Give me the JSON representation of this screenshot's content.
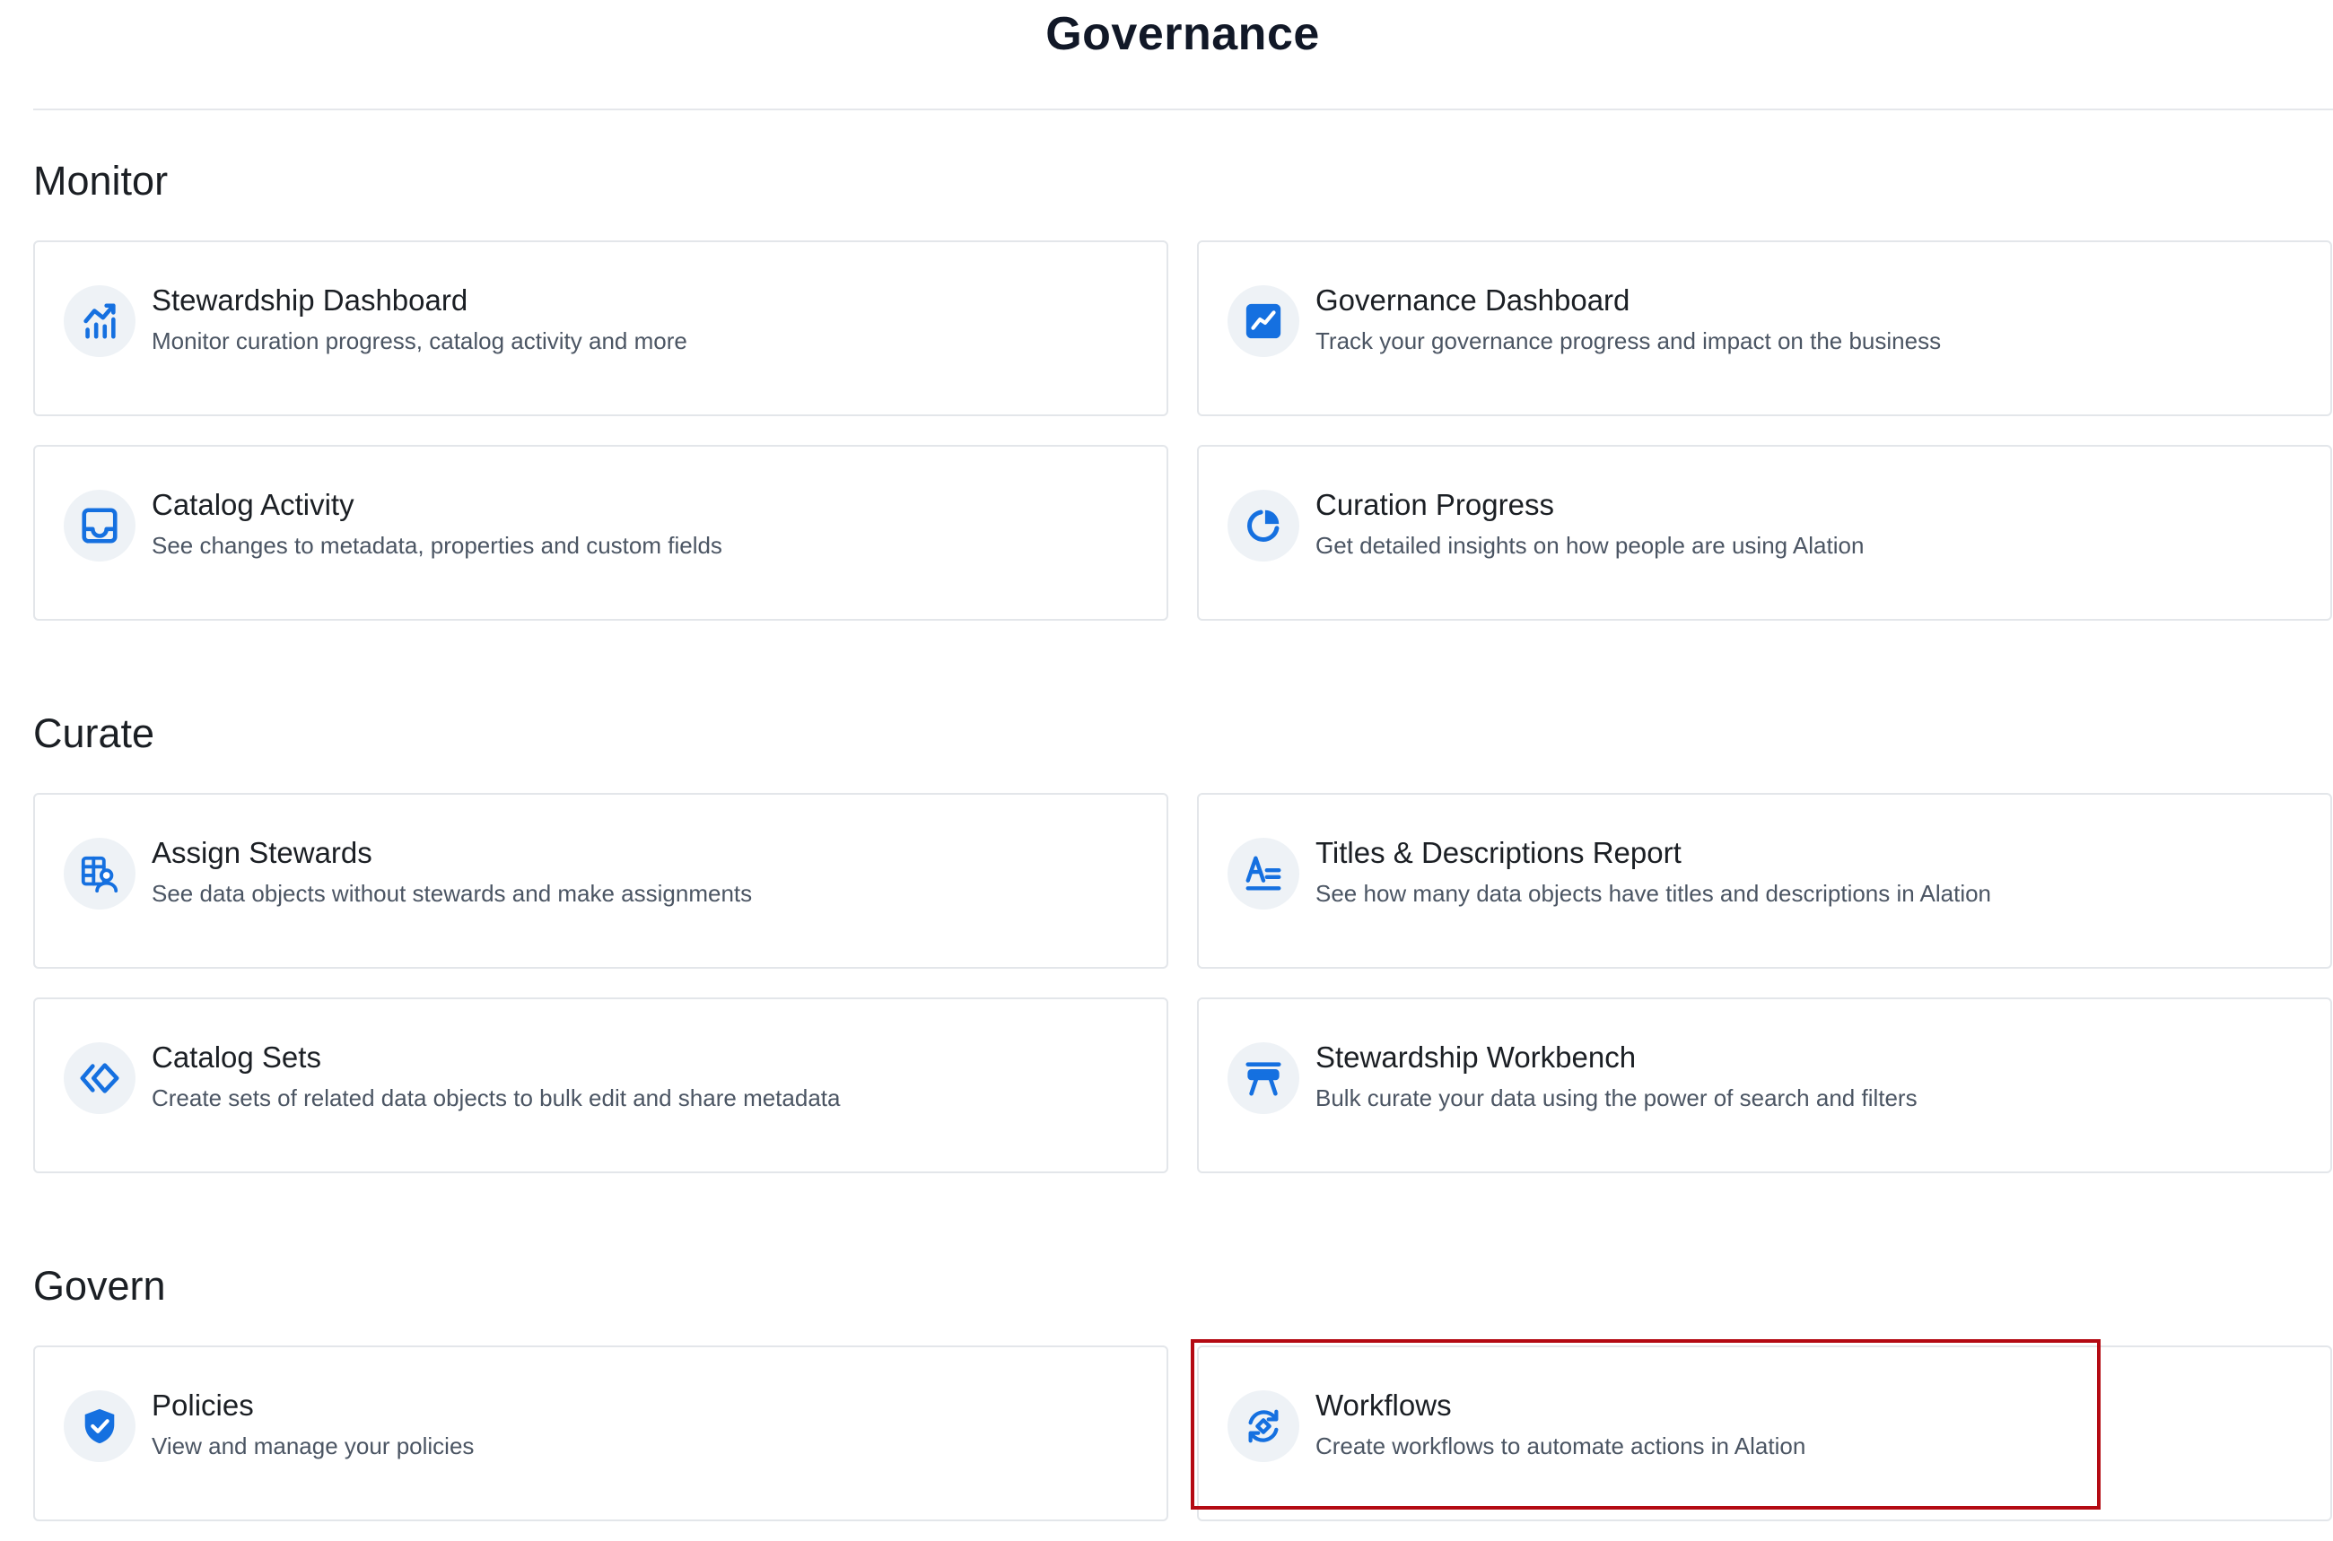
{
  "header": {
    "title": "Governance"
  },
  "colors": {
    "accent": "#1570e0",
    "highlight": "#b40a13"
  },
  "sections": {
    "monitor": {
      "heading": "Monitor",
      "cards": [
        {
          "title": "Stewardship Dashboard",
          "description": "Monitor curation progress, catalog activity and more",
          "icon": "bar-chart-trend-icon"
        },
        {
          "title": "Governance Dashboard",
          "description": "Track your governance progress and impact on the business",
          "icon": "trend-line-icon"
        },
        {
          "title": "Catalog Activity",
          "description": "See changes to metadata, properties and custom fields",
          "icon": "inbox-icon"
        },
        {
          "title": "Curation Progress",
          "description": "Get detailed insights on how people are using Alation",
          "icon": "pie-chart-icon"
        }
      ]
    },
    "curate": {
      "heading": "Curate",
      "cards": [
        {
          "title": "Assign Stewards",
          "description": "See data objects without stewards and make assignments",
          "icon": "assign-steward-icon"
        },
        {
          "title": "Titles & Descriptions Report",
          "description": "See how many data objects have titles and descriptions in Alation",
          "icon": "text-format-icon"
        },
        {
          "title": "Catalog Sets",
          "description": "Create sets of related data objects to bulk edit and share metadata",
          "icon": "catalog-sets-icon"
        },
        {
          "title": "Stewardship Workbench",
          "description": "Bulk curate your data using the power of search and filters",
          "icon": "workbench-icon"
        }
      ]
    },
    "govern": {
      "heading": "Govern",
      "cards": [
        {
          "title": "Policies",
          "description": "View and manage your policies",
          "icon": "shield-check-icon"
        },
        {
          "title": "Workflows",
          "description": "Create workflows to automate actions in Alation",
          "icon": "workflow-cycle-icon"
        }
      ]
    }
  }
}
